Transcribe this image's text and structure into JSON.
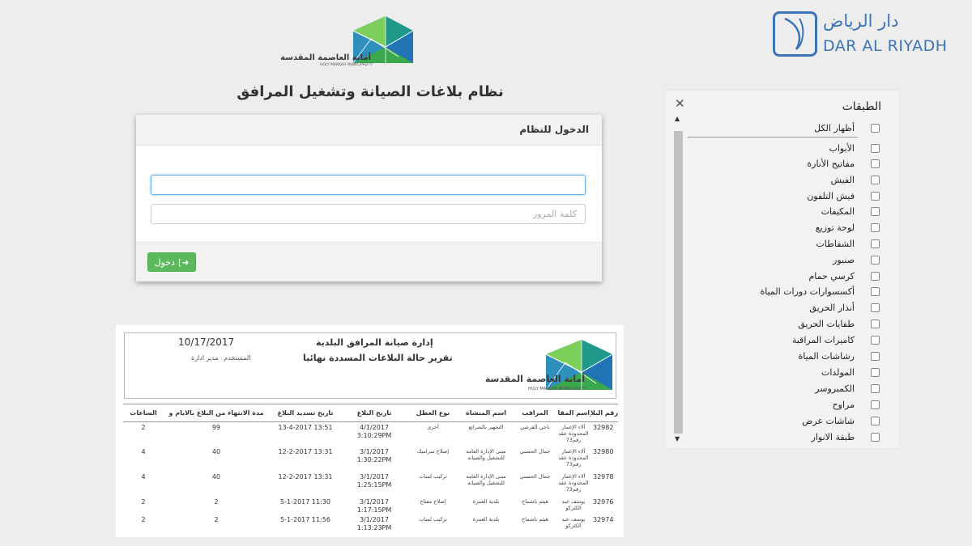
{
  "municipality": {
    "name_ar": "أمانة العاصمة المقدسة",
    "name_en": "HOLY MAKKAH MUNICIPALITY"
  },
  "system_title": "نظام بلاغات الصيانة وتشغيل المرافق",
  "login": {
    "header": "الدخول للنظام",
    "username_value": "",
    "password_placeholder": "كلمة المرور",
    "button_label": "دخول"
  },
  "brand": {
    "name_ar": "دار الرياض",
    "name_en": "DAR AL RIYADH",
    "color": "#3b75b8"
  },
  "layers": {
    "title": "الطبقات",
    "show_all": "أظهار الكل",
    "items": [
      "الأبواب",
      "مفاتيح الأنارة",
      "الفيش",
      "فيش التلفون",
      "المكيفات",
      "لوحة توزيع",
      "الشفاطات",
      "صنبور",
      "كرسي حمام",
      "أكسسوارات دورات المياة",
      "أنذار الحريق",
      "طفايات الحريق",
      "كاميرات المراقبة",
      "رشاشات المياة",
      "المولدات",
      "الكمبروسر",
      "مراوح",
      "شاشات عرض",
      "طبقة الانوار"
    ]
  },
  "report": {
    "department": "إدارة صيانة المرافق البلدية",
    "title": "تقرير حالة البلاغات المسددة نهائيا",
    "date": "10/17/2017",
    "user_label": "المستخدم",
    "user_value": "مدير ادارة",
    "columns": [
      "رقم البلاغ",
      "اسم المقاول",
      "المراقب",
      "اسم المنشاة",
      "نوع العطل",
      "تاريخ البلاغ",
      "تاريخ تسديد البلاغ",
      "مدة الانتهاء من البلاغ بالايام و",
      "الساعات"
    ],
    "rows": [
      {
        "no": "32982",
        "contractor": "آلاء الإعمار المحدودة عقد رقم73",
        "supervisor": "ناجي القرشي",
        "facility": "التجهيز بالشرائع",
        "fault": "أخرى",
        "report_date": "4/1/2017 3:10:29PM",
        "close_date": "13-4-2017 13:51",
        "days": "99",
        "hours": "2"
      },
      {
        "no": "32980",
        "contractor": "آلاء الإعمار المحدودة عقد رقم73",
        "supervisor": "جمال الحسني",
        "facility": "مبنى الإدارة العامه للتشغيل والصيانه",
        "fault": "إصلاح سراميك",
        "report_date": "3/1/2017 1:30:22PM",
        "close_date": "12-2-2017 13:31",
        "days": "40",
        "hours": "4"
      },
      {
        "no": "32978",
        "contractor": "آلاء الإعمار المحدودة عقد رقم73",
        "supervisor": "جمال الحسني",
        "facility": "مبنى الإدارة العامه للتشغيل والصيانه",
        "fault": "تركيب لمبات",
        "report_date": "3/1/2017 1:25:15PM",
        "close_date": "12-2-2017 13:31",
        "days": "40",
        "hours": "4"
      },
      {
        "no": "32976",
        "contractor": "يوسف عبد الكثركو",
        "supervisor": "هيثم باشماخ",
        "facility": "بلدية العمرة",
        "fault": "إصلاح مفتاح",
        "report_date": "3/1/2017 1:17:15PM",
        "close_date": "5-1-2017 11:30",
        "days": "2",
        "hours": "2"
      },
      {
        "no": "32974",
        "contractor": "يوسف عبد الكثركو",
        "supervisor": "هيثم باشماخ",
        "facility": "بلدية العمرة",
        "fault": "تركيب لمبات",
        "report_date": "3/1/2017 1:13:23PM",
        "close_date": "5-1-2017 11:56",
        "days": "2",
        "hours": "2"
      }
    ]
  }
}
